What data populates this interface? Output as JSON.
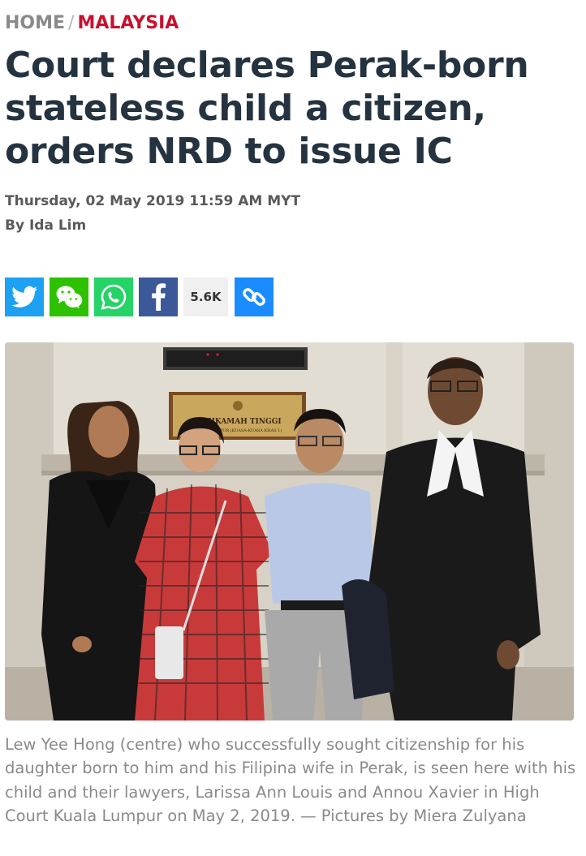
{
  "breadcrumb": {
    "home": "HOME",
    "separator": "/",
    "section": "MALAYSIA"
  },
  "article": {
    "headline": "Court declares Perak-born stateless child a citizen, orders NRD to issue IC",
    "date": "Thursday, 02 May 2019 11:59 AM MYT",
    "author": "By Ida Lim"
  },
  "share": {
    "buttons": [
      {
        "icon": "twitter-icon",
        "color": "#1da1f2"
      },
      {
        "icon": "wechat-icon",
        "color": "#2dc100"
      },
      {
        "icon": "whatsapp-icon",
        "color": "#25d366"
      },
      {
        "icon": "facebook-icon",
        "color": "#3b5998"
      }
    ],
    "count": "5.6K",
    "copy_link_icon": "link-icon"
  },
  "photo": {
    "sign_text": "MAHKAMAH TINGGI",
    "sign_subtext": "KUALA LUMPUR (KUASA-KUASA KHAS 1)"
  },
  "caption": "Lew Yee Hong (centre) who successfully sought citizenship for his daughter born to him and his Filipina wife in Perak, is seen here with his child and their lawyers, Larissa Ann Louis and Annou Xavier in High Court Kuala Lumpur on May 2, 2019. — Pictures by Miera Zulyana",
  "colors": {
    "accent": "#c8102e",
    "headline": "#24333f",
    "meta": "#5a5a5a",
    "caption": "#8a8a8a"
  }
}
